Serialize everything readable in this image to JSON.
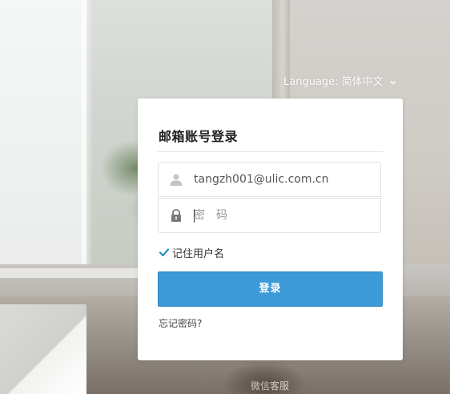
{
  "language": {
    "label": "Language: 简体中文",
    "icon": "chevron-down-icon"
  },
  "login_card": {
    "title": "邮箱账号登录",
    "username": {
      "value": "tangzh001@ulic.com.cn",
      "icon": "user-icon"
    },
    "password": {
      "placeholder": "密码",
      "icon": "lock-icon"
    },
    "remember": {
      "label": "记住用户名",
      "checked": true,
      "icon": "checkmark-icon"
    },
    "login_button": "登录",
    "forgot_link": "忘记密码?"
  },
  "footer": {
    "service_link": "微信客服"
  },
  "colors": {
    "primary": "#3d9ad9",
    "check": "#2a8fc0"
  }
}
